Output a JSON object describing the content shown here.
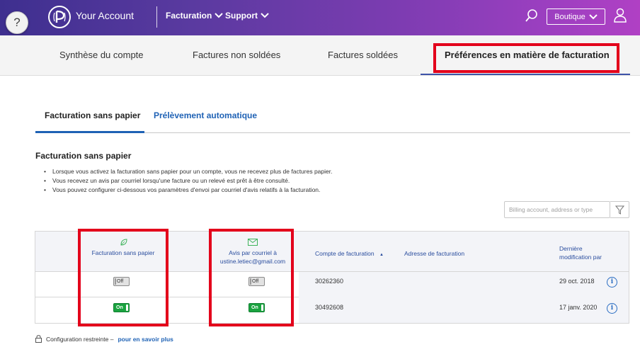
{
  "header": {
    "help_glyph": "?",
    "brand": "Your Account",
    "nav": [
      {
        "label": "Facturation"
      },
      {
        "label": "Support"
      }
    ],
    "boutique_label": "Boutique"
  },
  "subnav": {
    "tabs": [
      {
        "label": "Synthèse du compte"
      },
      {
        "label": "Factures non soldées"
      },
      {
        "label": "Factures soldées"
      },
      {
        "label": "Préférences en matière de facturation",
        "active": true
      }
    ]
  },
  "inner_tabs": [
    {
      "label": "Facturation sans papier",
      "active": true
    },
    {
      "label": "Prélèvement automatique"
    }
  ],
  "section": {
    "title": "Facturation sans papier",
    "bullets": [
      "Lorsque vous activez la facturation sans papier pour un compte, vous ne recevez plus de factures papier.",
      "Vous recevez un avis par courriel lorsqu'une facture ou un relevé est prêt à être consulté.",
      "Vous pouvez configurer ci-dessous vos paramètres d'envoi par courriel d'avis relatifs à la facturation."
    ]
  },
  "search": {
    "placeholder": "Billing account, address or type"
  },
  "table": {
    "headers": {
      "paperless": "Facturation sans papier",
      "email_notice_line1": "Avis par courriel à",
      "email_notice_line2": "ustine.letiec@gmail.com",
      "account": "Compte de facturation",
      "sort_glyph": "▲",
      "address": "Adresse de facturation",
      "modified_line1": "Dernière",
      "modified_line2": "modification par"
    },
    "rows": [
      {
        "paperless": "Off",
        "email": "Off",
        "account": "30262360",
        "address": "",
        "modified": "29 oct. 2018"
      },
      {
        "paperless": "On",
        "email": "On",
        "account": "30492608",
        "address": "",
        "modified": "17 janv. 2020"
      }
    ],
    "info_glyph": "i"
  },
  "footer": {
    "text": "Configuration restreinte –",
    "link": "pour en savoir plus"
  },
  "colors": {
    "accent": "#1f62b5",
    "annotation_red": "#e3001b",
    "toggle_on": "#1aa33f"
  }
}
